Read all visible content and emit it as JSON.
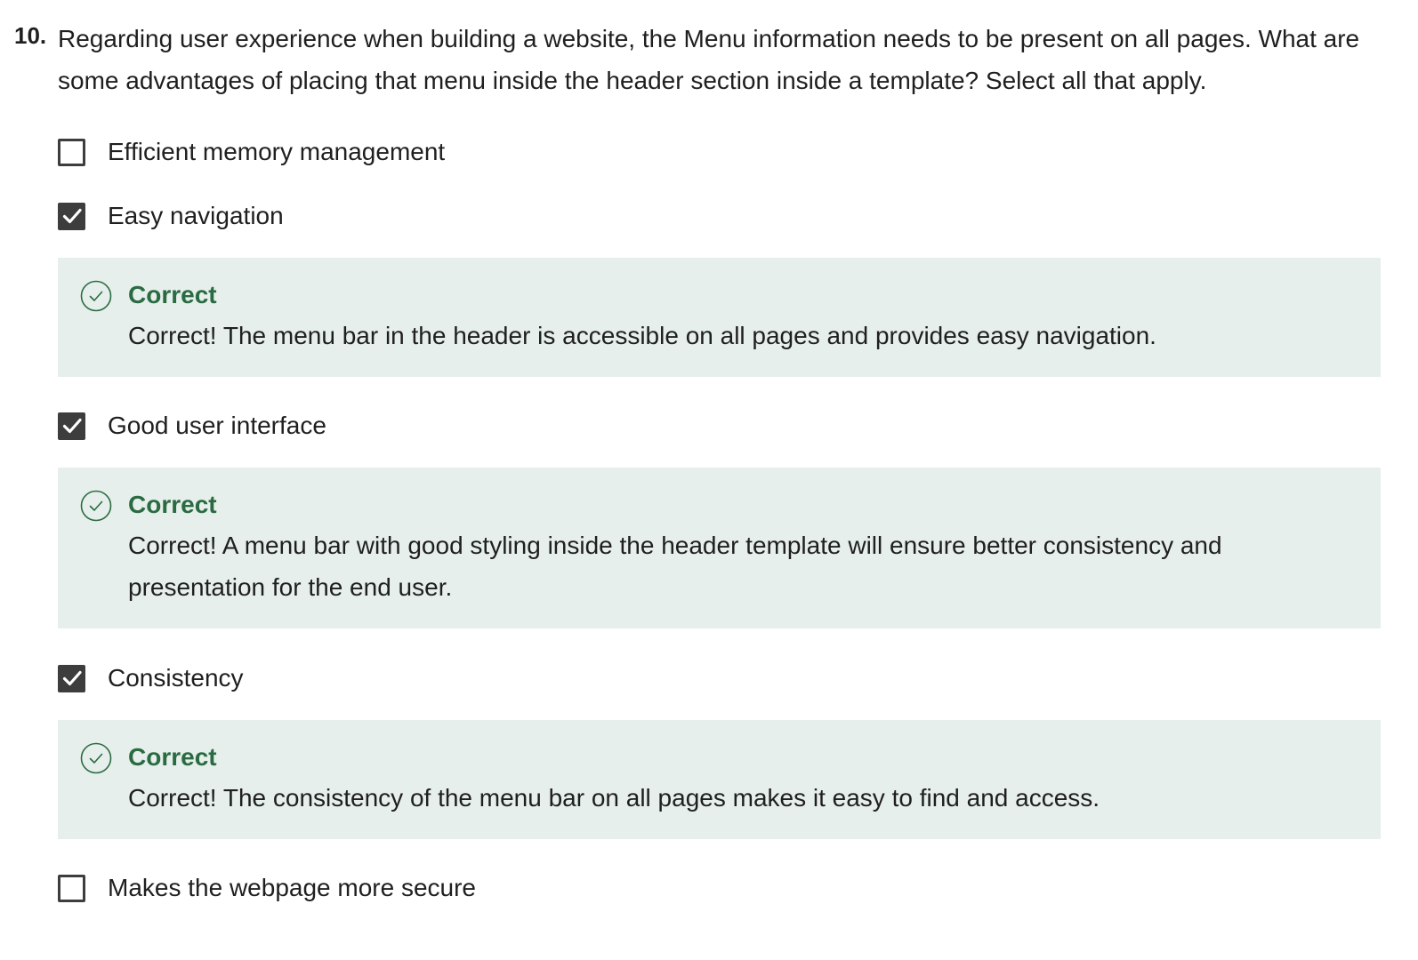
{
  "question": {
    "number": "10.",
    "text": "Regarding user experience when building a website, the Menu information needs to be present on all pages. What are some advantages of placing that menu inside the header section inside a template? Select all that apply."
  },
  "options": [
    {
      "label": "Efficient memory management",
      "checked": false
    },
    {
      "label": "Easy navigation",
      "checked": true
    },
    {
      "label": "Good user interface",
      "checked": true
    },
    {
      "label": "Consistency",
      "checked": true
    },
    {
      "label": "Makes the webpage more secure",
      "checked": false
    }
  ],
  "feedback": [
    {
      "title": "Correct",
      "text": "Correct! The menu bar in the header is accessible on all pages and provides easy navigation."
    },
    {
      "title": "Correct",
      "text": "Correct! A menu bar with good styling inside the header template will ensure better consistency and presentation for the end user."
    },
    {
      "title": "Correct",
      "text": "Correct! The consistency of the menu bar on all pages makes it easy to find and access."
    }
  ],
  "colors": {
    "feedback_background": "#e6efeb",
    "correct_green": "#2a6b42",
    "checkbox_dark": "#3d3d3d"
  },
  "icons": {
    "checkmark": "check-icon",
    "feedback": "check-circle-icon"
  }
}
